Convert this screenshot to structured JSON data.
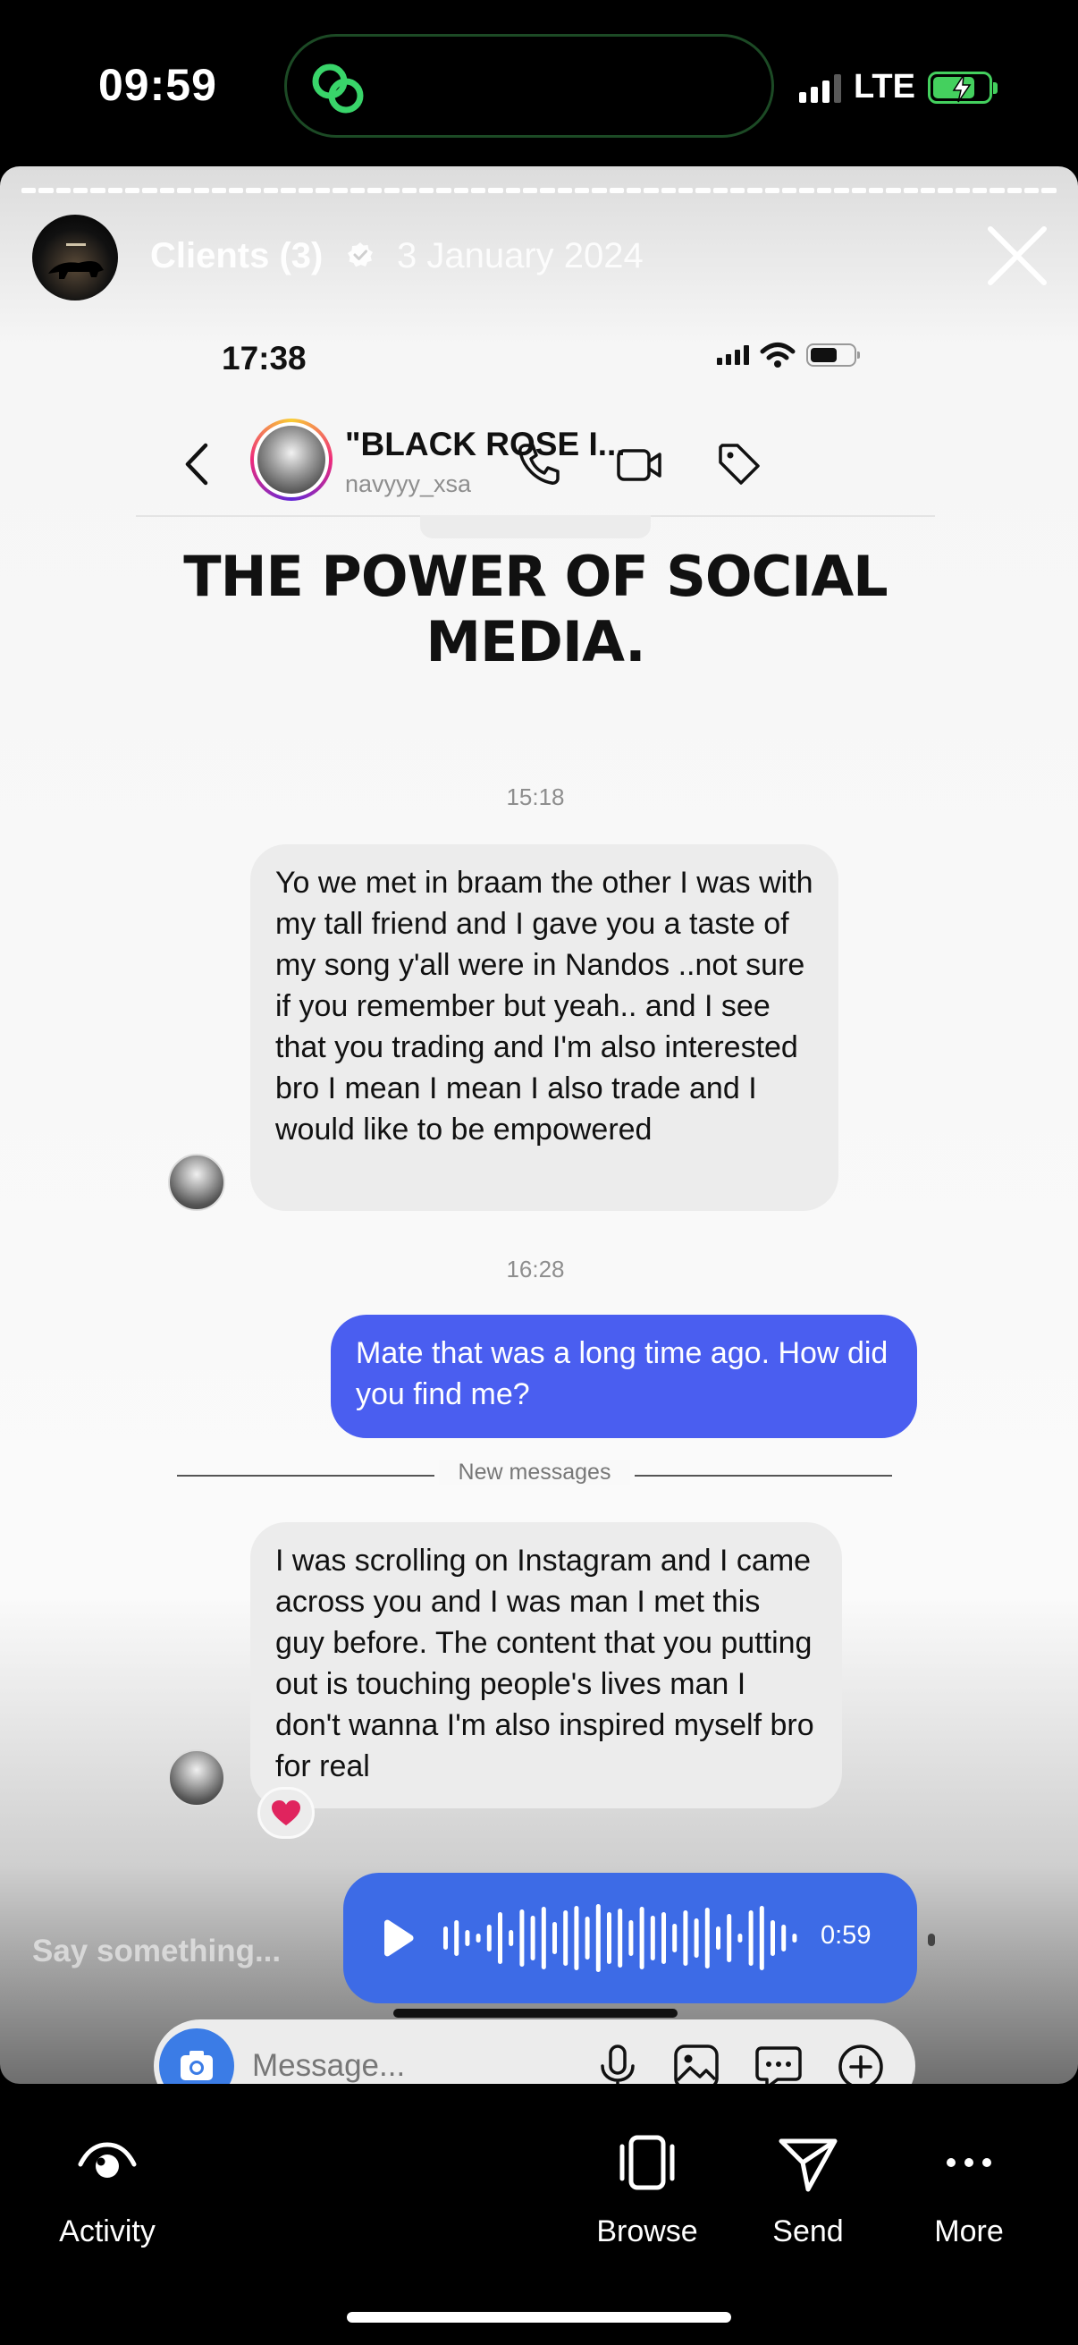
{
  "os_status": {
    "time": "09:59",
    "network": "LTE"
  },
  "story": {
    "title": "Clients (3)",
    "date": "3 January 2024",
    "reply_placeholder": "Say something..."
  },
  "screenshot": {
    "status_time": "17:38",
    "contact": {
      "name": "\"BLACK ROSE I...",
      "handle": "navyyy_xsa"
    },
    "headline": "THE POWER OF SOCIAL MEDIA.",
    "messages": [
      {
        "type": "timestamp",
        "text": "15:18"
      },
      {
        "type": "incoming",
        "text": "Yo we met in braam the other I was with my tall friend and I gave you a taste of my song y'all were in Nandos ..not sure if you remember but yeah.. and I see that you trading and I'm also interested bro I mean I mean I also trade and I would like to be empowered"
      },
      {
        "type": "timestamp",
        "text": "16:28"
      },
      {
        "type": "outgoing",
        "text": "Mate that was a long time ago. How did you find me?"
      },
      {
        "type": "divider",
        "text": "New messages"
      },
      {
        "type": "incoming",
        "text": "I was scrolling on Instagram and I came across you and I was man I met this guy before. The content that you putting out is touching people's lives man I don't wanna I'm also inspired myself bro for real",
        "reaction": "❤"
      },
      {
        "type": "voice",
        "duration": "0:59"
      }
    ],
    "composer_placeholder": "Message..."
  },
  "bottom_nav": [
    {
      "label": "Activity",
      "icon": "activity-eye-icon"
    },
    {
      "label": "Browse",
      "icon": "browse-icon"
    },
    {
      "label": "Send",
      "icon": "send-icon"
    },
    {
      "label": "More",
      "icon": "more-dots-icon"
    }
  ],
  "colors": {
    "outgoing_bubble": "#4a5ef0",
    "voice_bubble": "#3d6be6",
    "incoming_bubble": "#ececec",
    "battery_green": "#44d05e"
  }
}
